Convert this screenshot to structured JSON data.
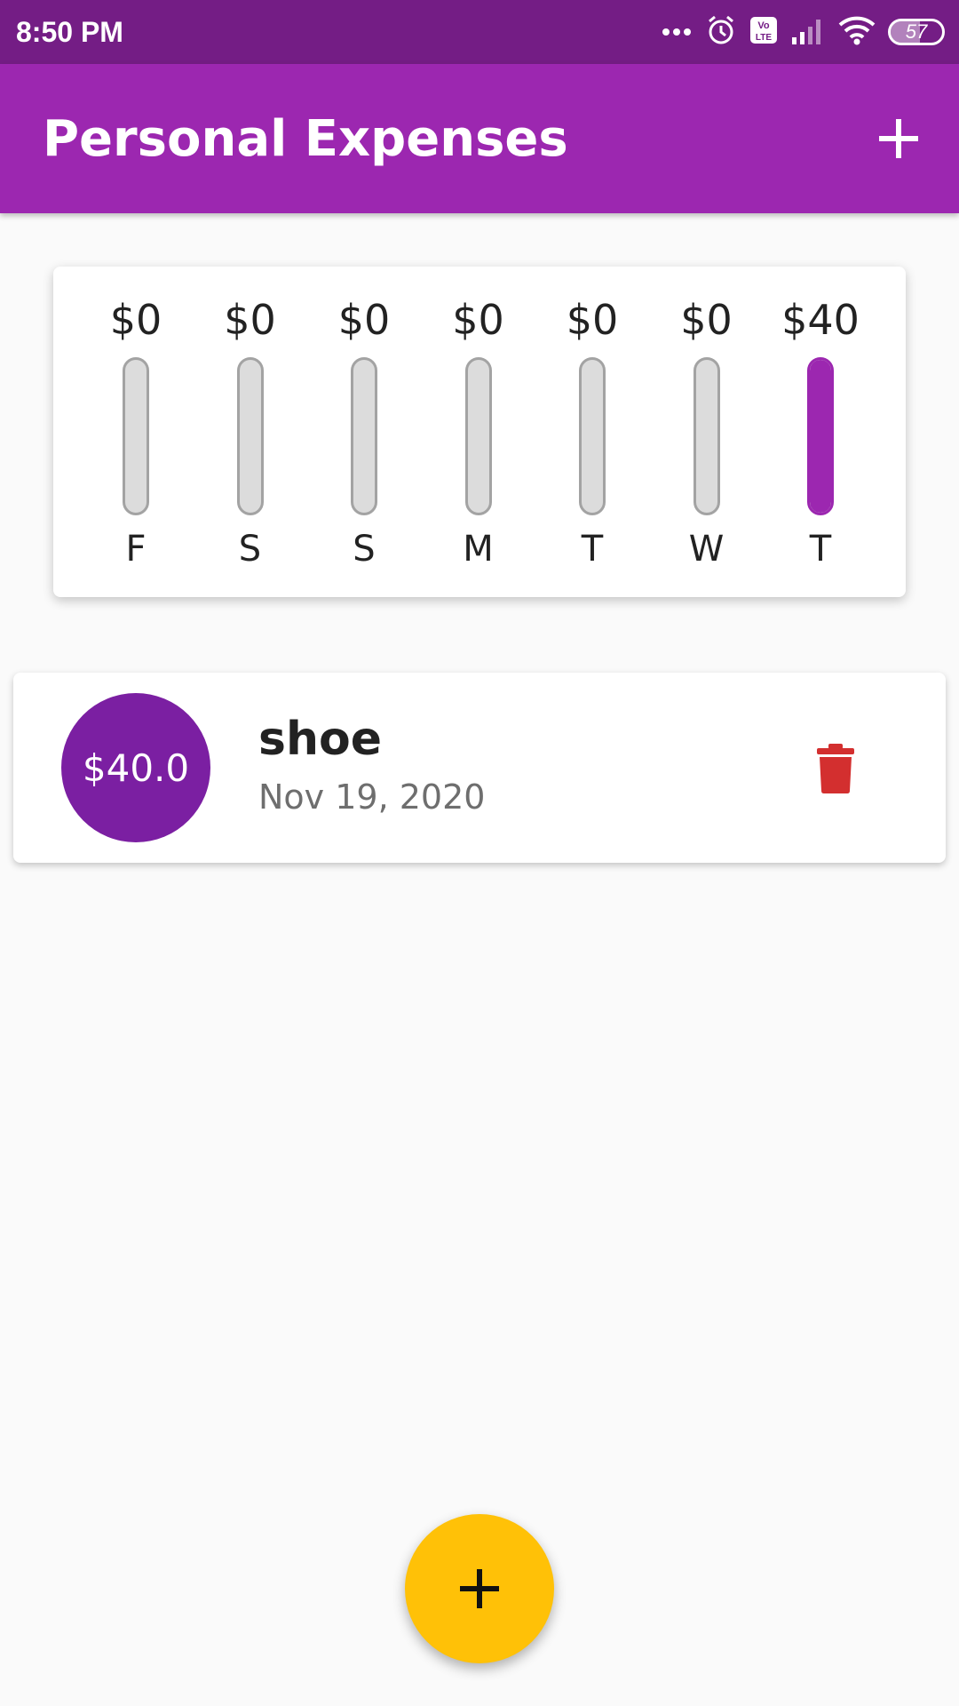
{
  "status_bar": {
    "time": "8:50 PM",
    "battery_level": "57",
    "battery_fraction": 0.57,
    "icons": [
      "more-dots-icon",
      "alarm-icon",
      "volte-icon",
      "signal-icon",
      "wifi-icon",
      "battery-icon"
    ]
  },
  "app_bar": {
    "title": "Personal Expenses",
    "add_icon": "plus-icon"
  },
  "chart_data": {
    "type": "bar",
    "categories": [
      "F",
      "S",
      "S",
      "M",
      "T",
      "W",
      "T"
    ],
    "values": [
      0,
      0,
      0,
      0,
      0,
      0,
      40
    ],
    "labels": [
      "$0",
      "$0",
      "$0",
      "$0",
      "$0",
      "$0",
      "$40"
    ],
    "fill_fractions": [
      0,
      0,
      0,
      0,
      0,
      0,
      1
    ],
    "title": "",
    "xlabel": "",
    "ylabel": "",
    "colors": {
      "fill": "#9c27b0",
      "track": "#dcdcdc",
      "track_border": "#a3a3a3"
    }
  },
  "transactions": [
    {
      "amount": "$40.0",
      "title": "shoe",
      "date": "Nov 19, 2020",
      "delete_icon": "trash-icon"
    }
  ],
  "fab": {
    "icon": "plus-icon"
  },
  "colors": {
    "primary": "#9c27b0",
    "primary_dark": "#741d85",
    "avatar": "#7b1fa2",
    "accent": "#ffc107",
    "delete": "#d32f2f",
    "background": "#fafafa"
  }
}
